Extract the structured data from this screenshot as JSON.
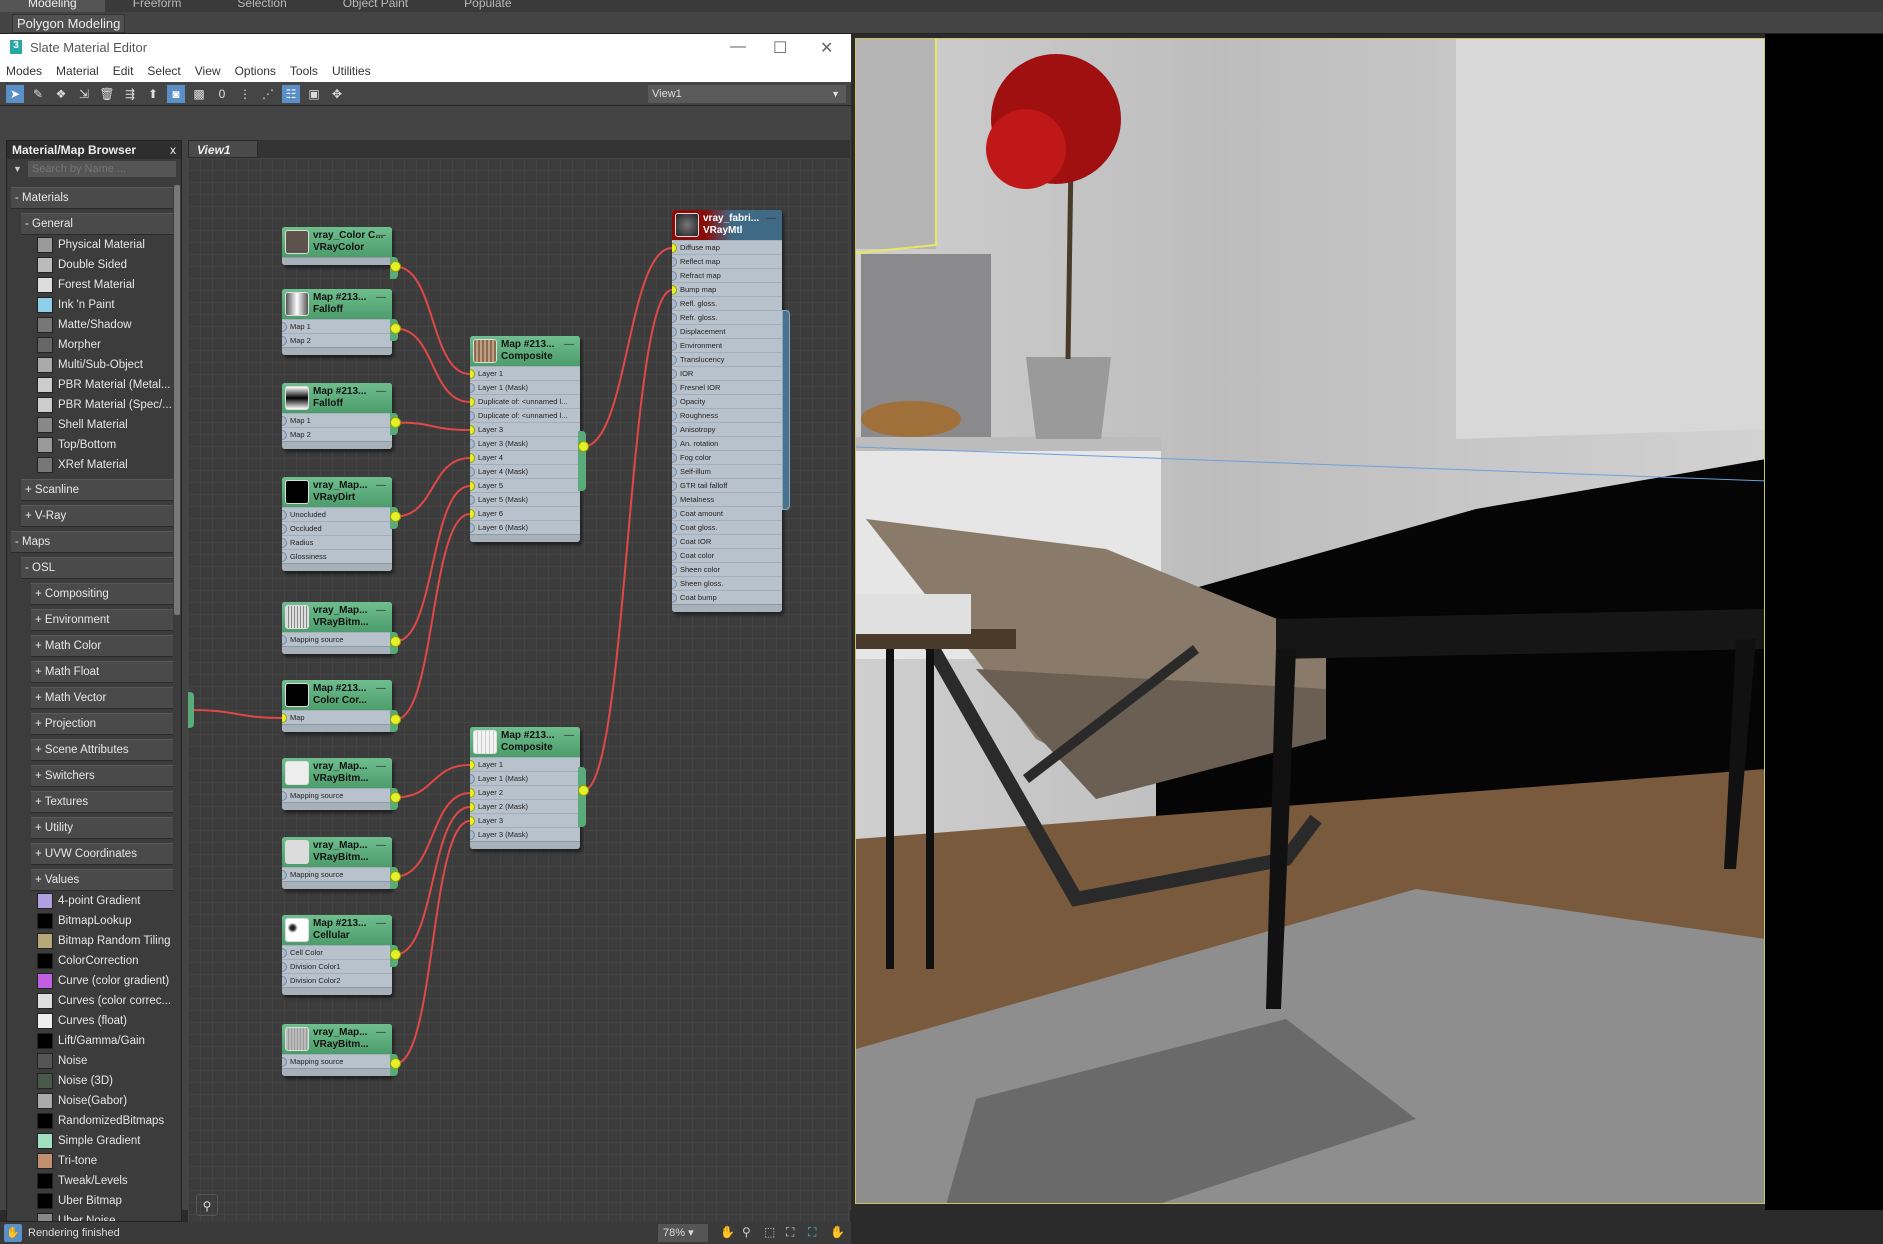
{
  "ribbon": {
    "tabs": [
      "Modeling",
      "Freeform",
      "Selection",
      "Object Paint",
      "Populate"
    ],
    "sub": "Polygon Modeling"
  },
  "window": {
    "title": "Slate Material Editor",
    "minimize": "—",
    "maximize": "☐",
    "close": "✕"
  },
  "menu": [
    "Modes",
    "Material",
    "Edit",
    "Select",
    "View",
    "Options",
    "Tools",
    "Utilities"
  ],
  "toolbar": {
    "icons": [
      "select-arrow-icon",
      "eyedropper-icon",
      "pick-material-icon",
      "put-to-scene-icon",
      "delete-icon",
      "move-children-icon",
      "hide-unused-icon",
      "show-map-icon",
      "show-background-icon",
      "material-id-icon",
      "layout-all-icon",
      "layout-children-icon",
      "material-map-browser-icon",
      "parameter-editor-icon",
      "select-by-material-icon"
    ],
    "view_select": "View1"
  },
  "browser": {
    "title": "Material/Map Browser",
    "close": "x",
    "search_placeholder": "Search by Name ...",
    "rows": [
      {
        "t": "g",
        "l": "- Materials",
        "d": 0
      },
      {
        "t": "g",
        "l": "- General",
        "d": 1
      },
      {
        "t": "i",
        "l": "Physical Material",
        "c": "#9a9a9a"
      },
      {
        "t": "i",
        "l": "Double Sided",
        "c": "#bbbbbb"
      },
      {
        "t": "i",
        "l": "Forest Material",
        "c": "#dddddd"
      },
      {
        "t": "i",
        "l": "Ink 'n Paint",
        "c": "#8fd0e8"
      },
      {
        "t": "i",
        "l": "Matte/Shadow",
        "c": "#777777"
      },
      {
        "t": "i",
        "l": "Morpher",
        "c": "#666666"
      },
      {
        "t": "i",
        "l": "Multi/Sub-Object",
        "c": "#aaaaaa"
      },
      {
        "t": "i",
        "l": "PBR Material (Metal...",
        "c": "#cccccc"
      },
      {
        "t": "i",
        "l": "PBR Material (Spec/...",
        "c": "#cccccc"
      },
      {
        "t": "i",
        "l": "Shell Material",
        "c": "#888888"
      },
      {
        "t": "i",
        "l": "Top/Bottom",
        "c": "#999999"
      },
      {
        "t": "i",
        "l": "XRef Material",
        "c": "#777777"
      },
      {
        "t": "g",
        "l": "+ Scanline",
        "d": 1
      },
      {
        "t": "g",
        "l": "+ V-Ray",
        "d": 1
      },
      {
        "t": "g",
        "l": "- Maps",
        "d": 0
      },
      {
        "t": "g",
        "l": "- OSL",
        "d": 1
      },
      {
        "t": "g",
        "l": "+ Compositing",
        "d": 2
      },
      {
        "t": "g",
        "l": "+ Environment",
        "d": 2
      },
      {
        "t": "g",
        "l": "+ Math Color",
        "d": 2
      },
      {
        "t": "g",
        "l": "+ Math Float",
        "d": 2
      },
      {
        "t": "g",
        "l": "+ Math Vector",
        "d": 2
      },
      {
        "t": "g",
        "l": "+ Projection",
        "d": 2
      },
      {
        "t": "g",
        "l": "+ Scene Attributes",
        "d": 2
      },
      {
        "t": "g",
        "l": "+ Switchers",
        "d": 2
      },
      {
        "t": "g",
        "l": "+ Textures",
        "d": 2
      },
      {
        "t": "g",
        "l": "+ Utility",
        "d": 2
      },
      {
        "t": "g",
        "l": "+ UVW Coordinates",
        "d": 2
      },
      {
        "t": "g",
        "l": "+ Values",
        "d": 2
      },
      {
        "t": "i",
        "l": "4-point Gradient",
        "c": "#b0a0e0"
      },
      {
        "t": "i",
        "l": "BitmapLookup",
        "c": "#000000"
      },
      {
        "t": "i",
        "l": "Bitmap Random Tiling",
        "c": "#b8a878"
      },
      {
        "t": "i",
        "l": "ColorCorrection",
        "c": "#000000"
      },
      {
        "t": "i",
        "l": "Curve (color gradient)",
        "c": "#c060e0"
      },
      {
        "t": "i",
        "l": "Curves (color correc...",
        "c": "#dddddd"
      },
      {
        "t": "i",
        "l": "Curves (float)",
        "c": "#eeeeee"
      },
      {
        "t": "i",
        "l": "Lift/Gamma/Gain",
        "c": "#000000"
      },
      {
        "t": "i",
        "l": "Noise",
        "c": "#555555"
      },
      {
        "t": "i",
        "l": "Noise (3D)",
        "c": "#4a5a4a"
      },
      {
        "t": "i",
        "l": "Noise(Gabor)",
        "c": "#aaaaaa"
      },
      {
        "t": "i",
        "l": "RandomizedBitmaps",
        "c": "#000000"
      },
      {
        "t": "i",
        "l": "Simple Gradient",
        "c": "#a0e0c0"
      },
      {
        "t": "i",
        "l": "Tri-tone",
        "c": "#c09070"
      },
      {
        "t": "i",
        "l": "Tweak/Levels",
        "c": "#000000"
      },
      {
        "t": "i",
        "l": "Uber Bitmap",
        "c": "#000000"
      },
      {
        "t": "i",
        "l": "Uber Noise",
        "c": "#888888"
      }
    ]
  },
  "view": {
    "tab": "View1"
  },
  "nodes": [
    {
      "name": "vray_Color C...",
      "type": "VRayColor",
      "thumb": "#5e524c",
      "inputs": []
    },
    {
      "name": "Map #213...",
      "type": "Falloff",
      "thumb": "linear-gradient(90deg,#555,#fff,#555)",
      "inputs": [
        "Map 1",
        "Map 2"
      ]
    },
    {
      "name": "Map #213...",
      "type": "Falloff",
      "thumb": "linear-gradient(#fff,#000,#fff)",
      "inputs": [
        "Map 1",
        "Map 2"
      ]
    },
    {
      "name": "vray_Map...",
      "type": "VRayDirt",
      "thumb": "#000000",
      "inputs": [
        "Unocluded",
        "Occluded",
        "Radius",
        "Glossiness"
      ]
    },
    {
      "name": "vray_Map...",
      "type": "VRayBitm...",
      "thumb": "repeating-linear-gradient(90deg,#ddd 0 2px,#888 2px 3px)",
      "inputs": [
        "Mapping source"
      ]
    },
    {
      "name": "Map #213...",
      "type": "Color Cor...",
      "thumb": "#000000",
      "inputs": [
        "Map"
      ]
    },
    {
      "name": "vray_Map...",
      "type": "VRayBitm...",
      "thumb": "#eeeeee",
      "inputs": [
        "Mapping source"
      ]
    },
    {
      "name": "vray_Map...",
      "type": "VRayBitm...",
      "thumb": "#dcdcdc",
      "inputs": [
        "Mapping source"
      ]
    },
    {
      "name": "Map #213...",
      "type": "Cellular",
      "thumb": "radial-gradient(circle at 30% 40%,#222 10%,#fff 25%)",
      "inputs": [
        "Cell Color",
        "Division Color1",
        "Division Color2"
      ]
    },
    {
      "name": "vray_Map...",
      "type": "VRayBitm...",
      "thumb": "repeating-linear-gradient(90deg,#bbb 0 2px,#999 2px 3px)",
      "inputs": [
        "Mapping source"
      ]
    },
    {
      "name": "Map #213...",
      "type": "Composite",
      "thumb": "repeating-linear-gradient(90deg,#8a6a50 0 2px,#c0a080 2px 4px)",
      "inputs": [
        "Layer 1",
        "Layer 1 (Mask)",
        "Duplicate of: <unnamed l...",
        "Duplicate of: <unnamed l...",
        "Layer 3",
        "Layer 3 (Mask)",
        "Layer 4",
        "Layer 4 (Mask)",
        "Layer 5",
        "Layer 5 (Mask)",
        "Layer 6",
        "Layer 6 (Mask)"
      ]
    },
    {
      "name": "Map #213...",
      "type": "Composite",
      "thumb": "repeating-linear-gradient(90deg,#f4f4f4 0 3px,#ccc 3px 4px)",
      "inputs": [
        "Layer 1",
        "Layer 1 (Mask)",
        "Layer 2",
        "Layer 2 (Mask)",
        "Layer 3",
        "Layer 3 (Mask)"
      ]
    },
    {
      "name": "vray_fabri...",
      "type": "VRayMtl",
      "thumb": "radial-gradient(circle,#777,#222)",
      "mtl": true,
      "inputs": [
        "Diffuse map",
        "Reflect map",
        "Refract map",
        "Bump map",
        "Refl. gloss.",
        "Refr. gloss.",
        "Displacement",
        "Environment",
        "Translucency",
        "IOR",
        "Fresnel IOR",
        "Opacity",
        "Roughness",
        "Anisotropy",
        "An. rotation",
        "Fog color",
        "Self-illum",
        "GTR tail falloff",
        "Metalness",
        "Coat amount",
        "Coat gloss.",
        "Coat IOR",
        "Coat color",
        "Sheen color",
        "Sheen gloss.",
        "Coat bump"
      ]
    }
  ],
  "connections": [
    [
      0,
      10,
      0
    ],
    [
      1,
      10,
      2
    ],
    [
      2,
      10,
      4
    ],
    [
      3,
      10,
      6
    ],
    [
      4,
      10,
      8
    ],
    [
      5,
      10,
      10
    ],
    [
      10,
      12,
      0
    ],
    [
      11,
      12,
      3
    ],
    [
      6,
      11,
      0
    ],
    [
      7,
      11,
      2
    ],
    [
      8,
      11,
      3
    ],
    [
      9,
      11,
      4
    ],
    [
      -1,
      5,
      0
    ]
  ],
  "colors": {
    "wire": "#e04848",
    "socket_connected": "#e4f12a",
    "node_header": "#5aa878"
  },
  "status": {
    "text": "Rendering finished",
    "zoom": "78%"
  }
}
